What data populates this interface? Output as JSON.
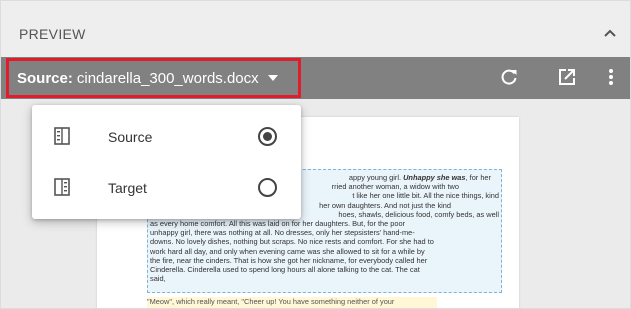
{
  "panel": {
    "title": "PREVIEW",
    "collapse_icon": "chevron-up-icon"
  },
  "toolbar": {
    "source_label": "Source:",
    "source_file": "cindarella_300_words.docx",
    "caret_icon": "caret-down-icon",
    "refresh_icon": "refresh-icon",
    "open_external_icon": "open-in-new-icon",
    "more_icon": "more-vertical-icon",
    "highlight_color": "#e21c2a"
  },
  "menu": {
    "items": [
      {
        "label": "Source",
        "icon": "source-pane-icon",
        "selected": true
      },
      {
        "label": "Target",
        "icon": "target-pane-icon",
        "selected": false
      }
    ]
  },
  "document": {
    "paragraph_1_parts": [
      "appy young girl. ",
      "Unhappy she was",
      ", for her",
      "rried another woman, a widow with two",
      "t like her one little bit. All the nice things, kind",
      "her own daughters. And not just the kind",
      "hoes, shawls, delicious food, comfy beds, as well",
      "as every home comfort. All this was laid on for her daughters. But, for the poor",
      "unhappy girl, there was nothing at all. No dresses, only her stepsisters' hand-me-",
      "downs. No lovely dishes, nothing but scraps. No nice rests and comfort. For she had to",
      "work hard all day, and only when evening came was she allowed to sit for a while by",
      "the fire, near the cinders. That is how she got her nickname, for everybody called her",
      "Cinderella. Cinderella used to spend long hours all alone talking to the cat. The cat",
      "said,"
    ],
    "paragraph_2": "\"Meow\", which really meant, \"Cheer up! You have something neither of your"
  }
}
